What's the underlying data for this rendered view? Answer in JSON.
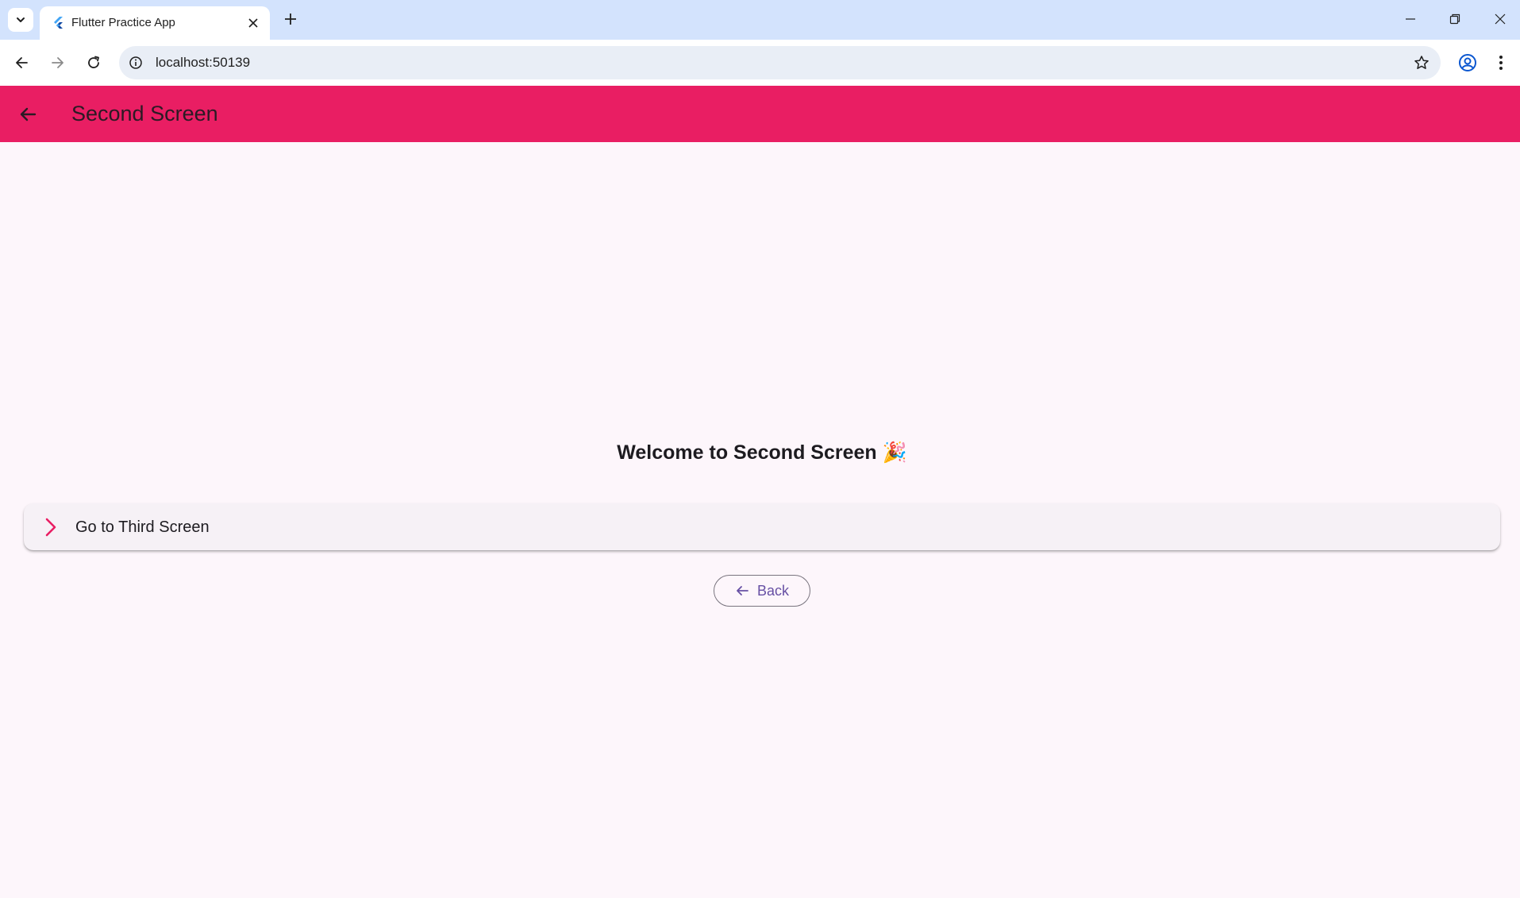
{
  "browser": {
    "tab": {
      "title": "Flutter Practice App"
    },
    "address_bar": {
      "url": "localhost:50139"
    },
    "icons": {
      "tab_dropdown": "chevron-down-icon",
      "favicon": "flutter-icon",
      "tab_close": "close-icon",
      "new_tab": "plus-icon",
      "minimize": "minimize-icon",
      "restore": "restore-icon",
      "close_window": "close-icon",
      "back": "arrow-left-icon",
      "forward": "arrow-right-icon",
      "reload": "reload-icon",
      "site_info": "info-icon",
      "bookmark": "star-icon",
      "profile": "account-icon",
      "menu": "more-vert-icon"
    }
  },
  "app": {
    "appbar": {
      "title": "Second Screen",
      "back_icon": "arrow-left-icon",
      "color": "#e91e63"
    },
    "welcome_text": "Welcome to Second Screen 🎉",
    "list_tile": {
      "label": "Go to Third Screen",
      "icon": "chevron-right-icon",
      "icon_color": "#e91e63"
    },
    "back_button": {
      "label": "Back",
      "icon": "arrow-left-icon",
      "color": "#6750a4"
    },
    "background_color": "#fdf6fb"
  }
}
